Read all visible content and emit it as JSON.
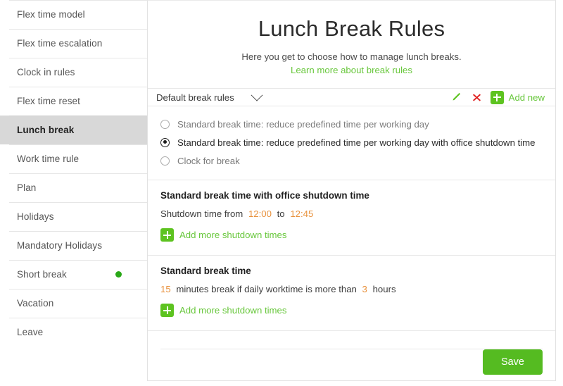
{
  "sidebar": {
    "items": [
      {
        "label": "Flex time model",
        "active": false,
        "dot": false
      },
      {
        "label": "Flex time escalation",
        "active": false,
        "dot": false
      },
      {
        "label": "Clock in rules",
        "active": false,
        "dot": false
      },
      {
        "label": "Flex time reset",
        "active": false,
        "dot": false
      },
      {
        "label": "Lunch break",
        "active": true,
        "dot": false
      },
      {
        "label": "Work time rule",
        "active": false,
        "dot": false
      },
      {
        "label": "Plan",
        "active": false,
        "dot": false
      },
      {
        "label": "Holidays",
        "active": false,
        "dot": false
      },
      {
        "label": "Mandatory Holidays",
        "active": false,
        "dot": false
      },
      {
        "label": "Short break",
        "active": false,
        "dot": true
      },
      {
        "label": "Vacation",
        "active": false,
        "dot": false
      },
      {
        "label": "Leave",
        "active": false,
        "dot": false
      }
    ]
  },
  "header": {
    "title": "Lunch Break Rules",
    "subtitle": "Here you get to choose how to manage lunch breaks.",
    "link_text": "Learn more about break rules"
  },
  "selector": {
    "value": "Default break rules",
    "chevron_icon": "chevron-down-icon",
    "edit_icon": "pencil-icon",
    "delete_icon": "close-x-icon",
    "add_icon": "plus-icon",
    "add_label": "Add new"
  },
  "radio_group": {
    "options": [
      {
        "label": "Standard break time: reduce predefined time per working day",
        "selected": false
      },
      {
        "label": "Standard break time: reduce predefined time per working day with office shutdown time",
        "selected": true
      },
      {
        "label": "Clock for break",
        "selected": false
      }
    ]
  },
  "shutdown_section": {
    "title": "Standard break time with office shutdown time",
    "line_prefix": "Shutdown time from",
    "from_value": "12:00",
    "line_middle": "to",
    "to_value": "12:45",
    "add_label": "Add more shutdown times",
    "add_icon": "plus-icon"
  },
  "standard_section": {
    "title": "Standard break time",
    "minutes_value": "15",
    "line_middle": "minutes break if daily worktime is more than",
    "hours_value": "3",
    "line_suffix": "hours",
    "add_label": "Add more shutdown times",
    "add_icon": "plus-icon"
  },
  "footer": {
    "save_label": "Save"
  },
  "colors": {
    "green_accent": "#68c73c",
    "green_button": "#55bb21",
    "green_box": "#5dc320",
    "orange_value": "#e8913c",
    "red_delete": "#e02020",
    "status_dot": "#2aa818",
    "active_row": "#d8d8d8"
  }
}
